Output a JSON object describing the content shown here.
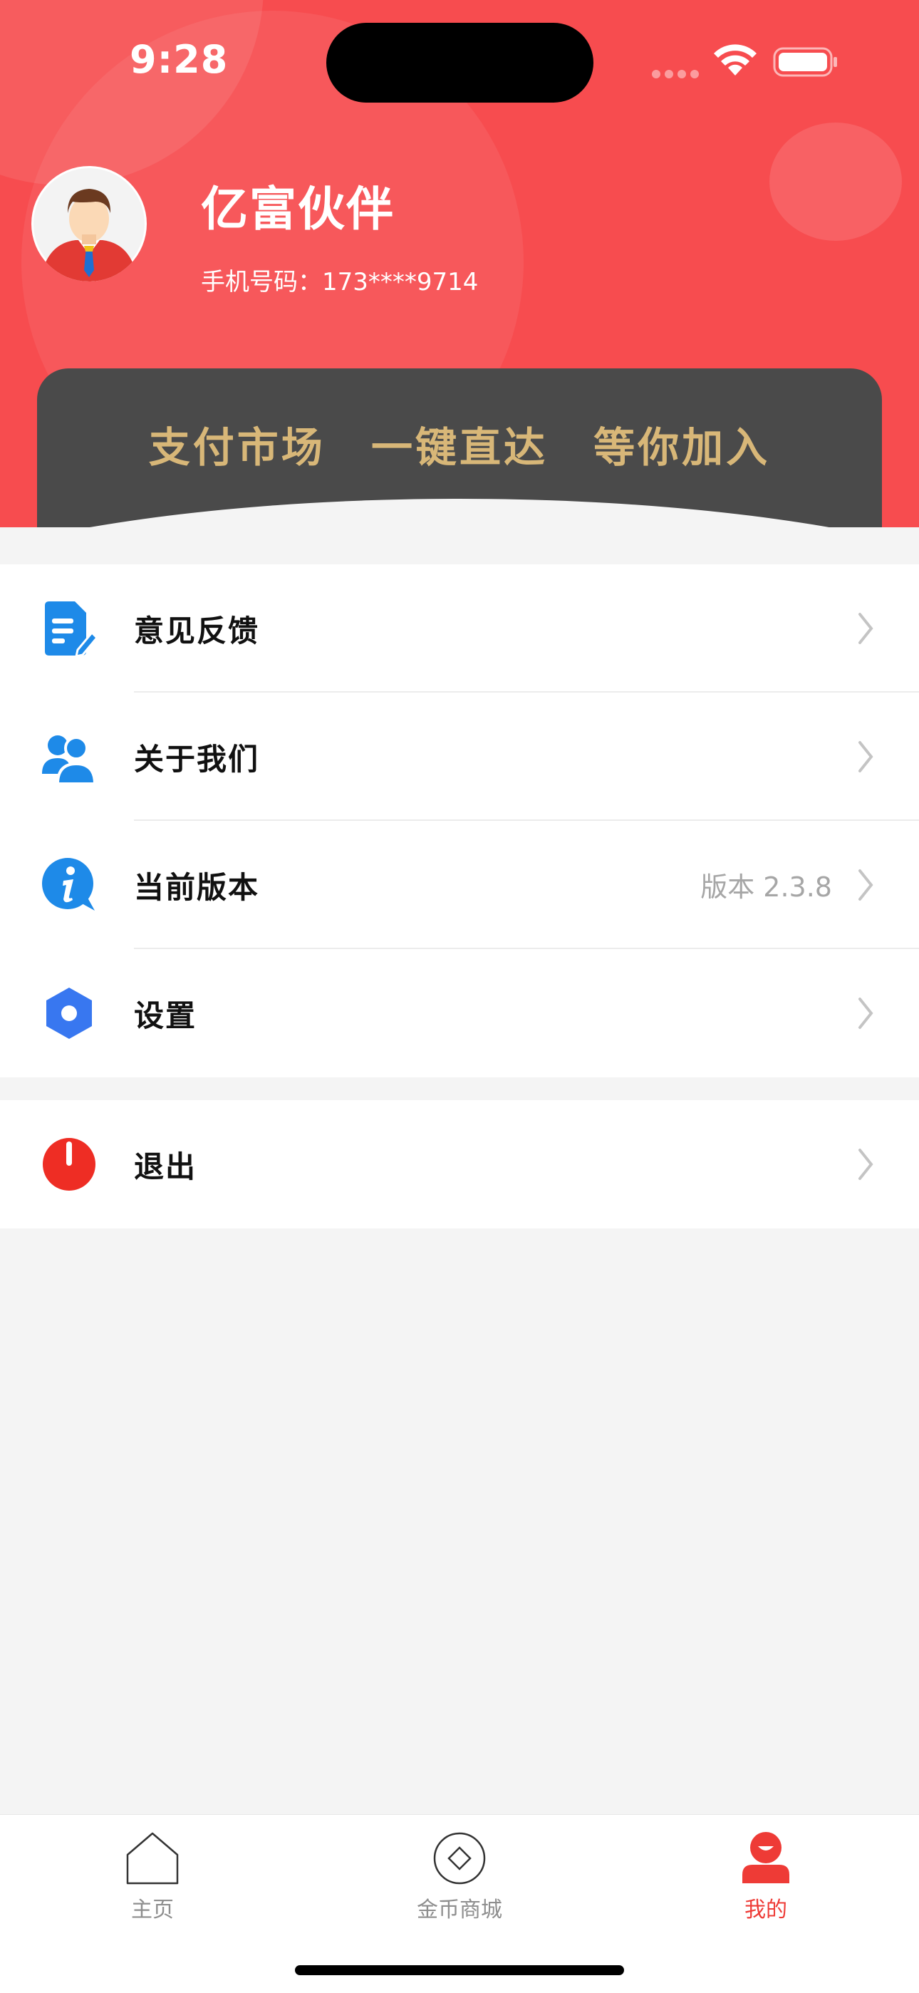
{
  "status_bar": {
    "time": "9:28"
  },
  "profile": {
    "name": "亿富伙伴",
    "phone": "手机号码：173****9714"
  },
  "banner": {
    "text": "支付市场 一键直达 等你加入"
  },
  "menu": [
    {
      "label": "意见反馈",
      "icon": "feedback-doc-icon",
      "value": ""
    },
    {
      "label": "关于我们",
      "icon": "users-icon",
      "value": ""
    },
    {
      "label": "当前版本",
      "icon": "info-icon",
      "value": "版本 2.3.8"
    },
    {
      "label": "设置",
      "icon": "settings-hexagon-icon",
      "value": ""
    }
  ],
  "logout": {
    "label": "退出",
    "icon": "power-icon"
  },
  "tabs": [
    {
      "label": "主页",
      "icon": "home-icon",
      "active": false
    },
    {
      "label": "金币商城",
      "icon": "coin-icon",
      "active": false
    },
    {
      "label": "我的",
      "icon": "person-icon",
      "active": true
    }
  ],
  "colors": {
    "header": "#f74c4f",
    "banner_bg": "#4a4a4a",
    "banner_text": "#d8b778",
    "accent": "#ee3b36",
    "icon_blue": "#1e8ae8"
  }
}
